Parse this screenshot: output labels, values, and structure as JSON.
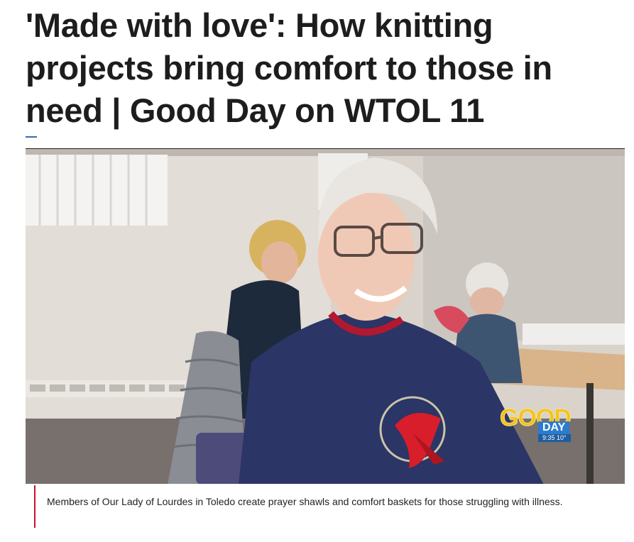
{
  "article": {
    "headline": "'Made with love': How knitting projects bring comfort to those in need | Good Day on WTOL 11",
    "caption": "Members of Our Lady of Lourdes in Toledo create prayer shawls and comfort baskets for those struggling with illness."
  },
  "video_bug": {
    "good": "GOOD",
    "day": "DAY",
    "time": "9:35  10°"
  },
  "colors": {
    "accent_rule": "#2a6fb8",
    "caption_rule": "#c8102e",
    "bug_yellow": "#f3c21b",
    "bug_blue": "#2b7ccc"
  }
}
